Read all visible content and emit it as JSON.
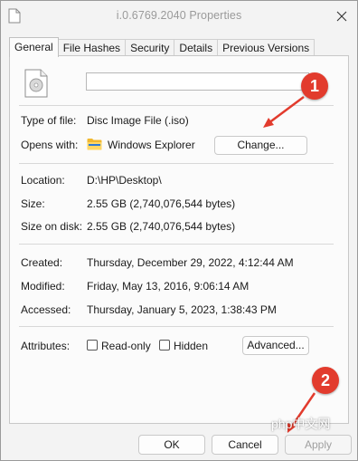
{
  "window": {
    "title": "i.0.6769.2040 Properties",
    "close_icon": "close-icon"
  },
  "tabs": [
    {
      "label": "General",
      "active": true
    },
    {
      "label": "File Hashes",
      "active": false
    },
    {
      "label": "Security",
      "active": false
    },
    {
      "label": "Details",
      "active": false
    },
    {
      "label": "Previous Versions",
      "active": false
    }
  ],
  "general": {
    "file_name": "",
    "type_of_file_label": "Type of file:",
    "type_of_file_value": "Disc Image File (.iso)",
    "opens_with_label": "Opens with:",
    "opens_with_value": "Windows Explorer",
    "change_button": "Change...",
    "location_label": "Location:",
    "location_value": "D:\\HP\\Desktop\\",
    "size_label": "Size:",
    "size_value": "2.55 GB (2,740,076,544 bytes)",
    "size_on_disk_label": "Size on disk:",
    "size_on_disk_value": "2.55 GB (2,740,076,544 bytes)",
    "created_label": "Created:",
    "created_value": "Thursday, December 29, 2022, 4:12:44 AM",
    "modified_label": "Modified:",
    "modified_value": "Friday, May 13, 2016, 9:06:14 AM",
    "accessed_label": "Accessed:",
    "accessed_value": "Thursday, January 5, 2023, 1:38:43 PM",
    "attributes_label": "Attributes:",
    "readonly_label": "Read-only",
    "readonly_checked": false,
    "hidden_label": "Hidden",
    "hidden_checked": false,
    "advanced_button": "Advanced..."
  },
  "footer": {
    "ok_button": "OK",
    "cancel_button": "Cancel",
    "apply_button": "Apply"
  },
  "annotations": {
    "badge_1": "1",
    "badge_2": "2",
    "accent_color": "#e23b2d"
  },
  "watermark": "php中文网"
}
